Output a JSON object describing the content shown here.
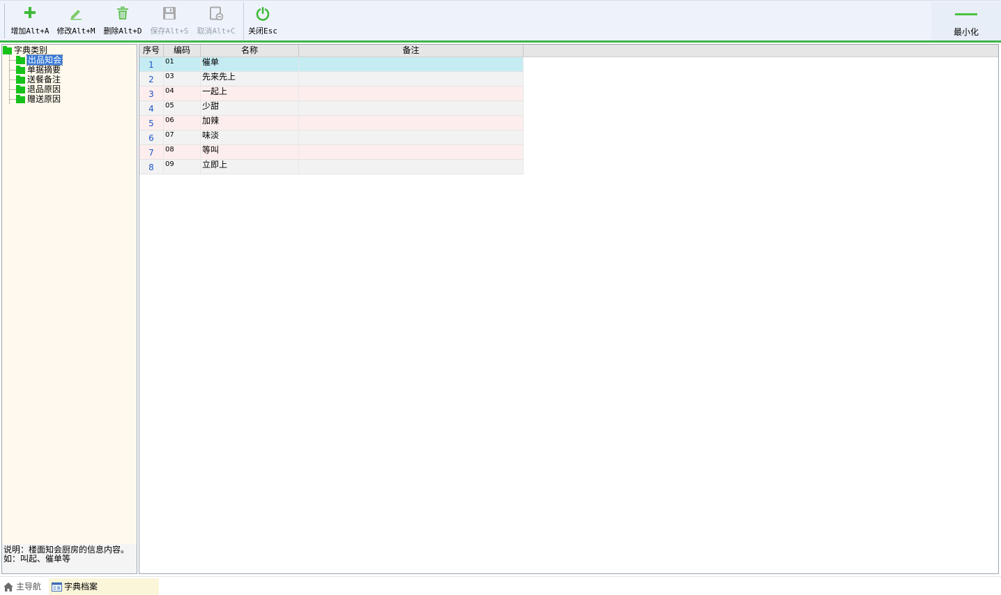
{
  "toolbar": {
    "buttons": [
      {
        "label": "增加Alt+A",
        "icon": "plus-icon",
        "enabled": true
      },
      {
        "label": "修改Alt+M",
        "icon": "pencil-icon",
        "enabled": true
      },
      {
        "label": "删除Alt+D",
        "icon": "trash-icon",
        "enabled": true
      },
      {
        "label": "保存Alt+S",
        "icon": "save-icon",
        "enabled": false
      },
      {
        "label": "取消Alt+C",
        "icon": "cancel-icon",
        "enabled": false
      },
      {
        "label": "关闭Esc",
        "icon": "power-icon",
        "enabled": true
      }
    ],
    "minimize_label": "最小化"
  },
  "tree": {
    "root": "字典类别",
    "items": [
      {
        "label": "出品知会",
        "selected": true
      },
      {
        "label": "单据摘要",
        "selected": false
      },
      {
        "label": "送餐备注",
        "selected": false
      },
      {
        "label": "退品原因",
        "selected": false
      },
      {
        "label": "赠送原因",
        "selected": false
      }
    ]
  },
  "note": {
    "line1": "说明：楼面知会厨房的信息内容。",
    "line2": "如：叫起、催单等"
  },
  "grid": {
    "columns": [
      "序号",
      "编码",
      "名称",
      "备注"
    ],
    "rows": [
      {
        "seq": "1",
        "code": "01",
        "name": "催单",
        "remark": ""
      },
      {
        "seq": "2",
        "code": "03",
        "name": "先来先上",
        "remark": ""
      },
      {
        "seq": "3",
        "code": "04",
        "name": "一起上",
        "remark": ""
      },
      {
        "seq": "4",
        "code": "05",
        "name": "少甜",
        "remark": ""
      },
      {
        "seq": "5",
        "code": "06",
        "name": "加辣",
        "remark": ""
      },
      {
        "seq": "6",
        "code": "07",
        "name": "味淡",
        "remark": ""
      },
      {
        "seq": "7",
        "code": "08",
        "name": "等叫",
        "remark": ""
      },
      {
        "seq": "8",
        "code": "09",
        "name": "立即上",
        "remark": ""
      }
    ]
  },
  "tabs": {
    "home": "主导航",
    "active": "字典档案"
  },
  "colors": {
    "accent_green": "#3cb54a",
    "selected_row": "#c5ecf3",
    "odd_row": "#fdeeed",
    "even_row": "#f2f2f2",
    "tree_bg": "#fffaed"
  }
}
